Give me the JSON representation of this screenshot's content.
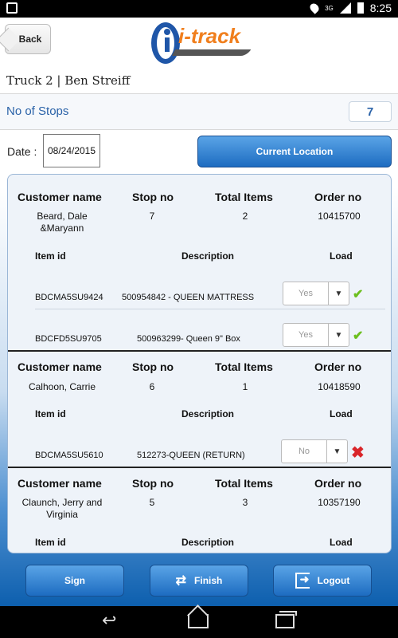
{
  "status_bar": {
    "time": "8:25",
    "network": "3G"
  },
  "header": {
    "back_label": "Back",
    "logo_text": "i-track"
  },
  "truck_title": "Truck 2 | Ben Streiff",
  "stops": {
    "label": "No of Stops",
    "value": "7"
  },
  "date": {
    "label": "Date :",
    "value": "08/24/2015"
  },
  "current_location_label": "Current Location",
  "table_headers": {
    "customer_name": "Customer name",
    "stop_no": "Stop no",
    "total_items": "Total Items",
    "order_no": "Order no",
    "item_id": "Item id",
    "description": "Description",
    "load": "Load"
  },
  "orders": [
    {
      "customer_name": "Beard, Dale &Maryann",
      "stop_no": "7",
      "total_items": "2",
      "order_no": "10415700",
      "items": [
        {
          "item_id": "BDCMA5SU9424",
          "description": "500954842 - QUEEN MATTRESS",
          "load": "Yes",
          "status_icon": "check-icon"
        },
        {
          "item_id": "BDCFD5SU9705",
          "description": "500963299- Queen 9\" Box",
          "load": "Yes",
          "status_icon": "check-icon"
        }
      ]
    },
    {
      "customer_name": "Calhoon, Carrie",
      "stop_no": "6",
      "total_items": "1",
      "order_no": "10418590",
      "items": [
        {
          "item_id": "BDCMA5SU5610",
          "description": "512273-QUEEN (RETURN)",
          "load": "No",
          "status_icon": "cross-icon"
        }
      ]
    },
    {
      "customer_name": "Claunch, Jerry and Virginia",
      "stop_no": "5",
      "total_items": "3",
      "order_no": "10357190",
      "items": []
    }
  ],
  "bottom_buttons": {
    "sign": "Sign",
    "finish": "Finish",
    "logout": "Logout"
  },
  "colors": {
    "accent_blue": "#1d6cc1",
    "logo_orange": "#f07f1e",
    "check_green": "#6cbf1e",
    "cross_red": "#d9252a"
  }
}
